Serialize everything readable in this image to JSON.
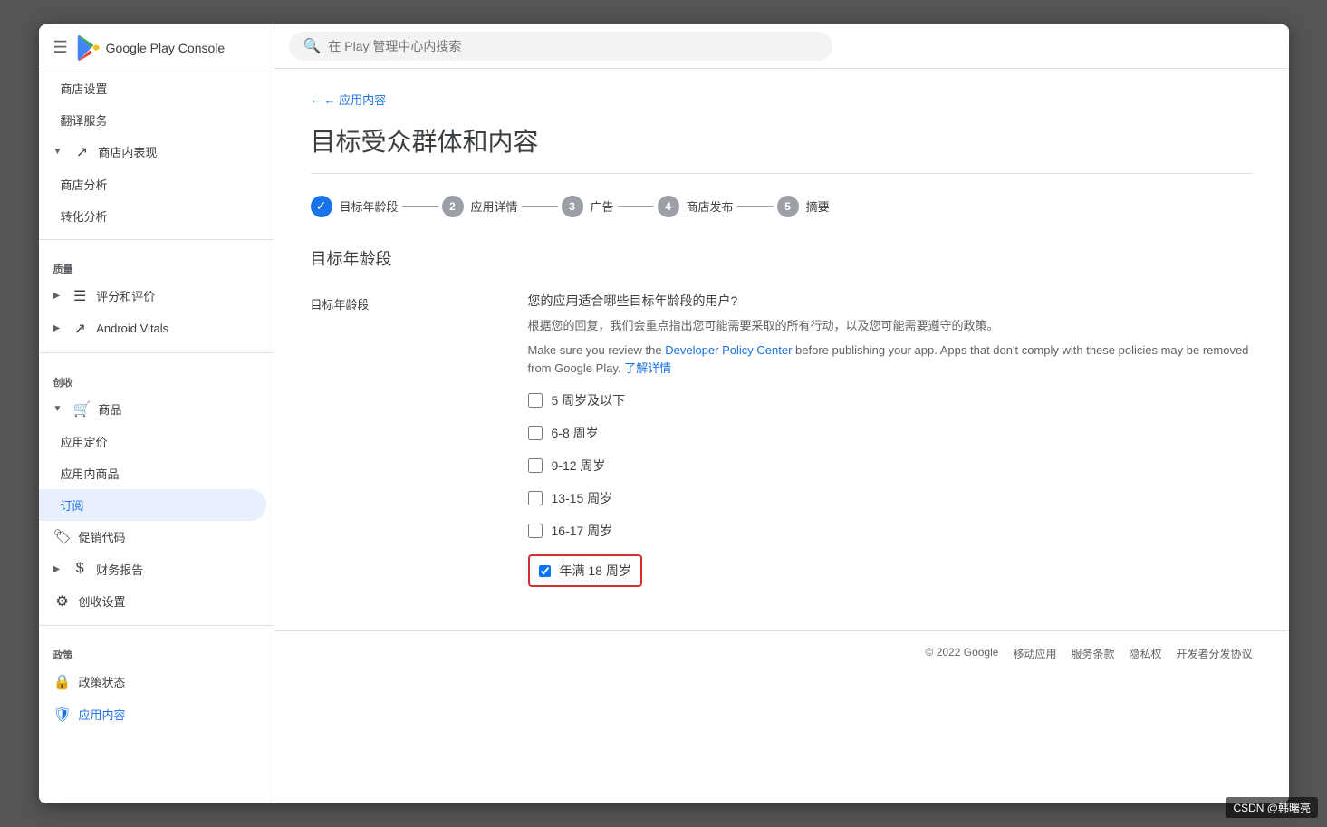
{
  "header": {
    "logo_text": "Google Play Console",
    "search_placeholder": "在 Play 管理中心内搜索"
  },
  "sidebar": {
    "items": [
      {
        "id": "store-settings",
        "label": "商店设置",
        "icon": "",
        "level": 1
      },
      {
        "id": "translation-service",
        "label": "翻译服务",
        "icon": "",
        "level": 1
      },
      {
        "id": "store-performance",
        "label": "商店内表现",
        "icon": "↗",
        "level": 0,
        "expandable": true
      },
      {
        "id": "store-analysis",
        "label": "商店分析",
        "icon": "",
        "level": 1
      },
      {
        "id": "conversion-analysis",
        "label": "转化分析",
        "icon": "",
        "level": 1
      },
      {
        "id": "quality-section",
        "label": "质量",
        "type": "section"
      },
      {
        "id": "ratings",
        "label": "评分和评价",
        "icon": "☰",
        "level": 0,
        "expandable": true
      },
      {
        "id": "android-vitals",
        "label": "Android Vitals",
        "icon": "↗",
        "level": 0,
        "expandable": true
      },
      {
        "id": "monetize-section",
        "label": "创收",
        "type": "section"
      },
      {
        "id": "products",
        "label": "商品",
        "icon": "🛒",
        "level": 0,
        "expandable": true,
        "expanded": true
      },
      {
        "id": "app-pricing",
        "label": "应用定价",
        "icon": "",
        "level": 1
      },
      {
        "id": "in-app-products",
        "label": "应用内商品",
        "icon": "",
        "level": 1
      },
      {
        "id": "subscriptions",
        "label": "订阅",
        "icon": "",
        "level": 1,
        "active": true
      },
      {
        "id": "promo-codes",
        "label": "促销代码",
        "icon": "🏷",
        "level": 0
      },
      {
        "id": "financial-reports",
        "label": "财务报告",
        "icon": "$",
        "level": 0,
        "expandable": true
      },
      {
        "id": "monetize-settings",
        "label": "创收设置",
        "icon": "⚙",
        "level": 0
      },
      {
        "id": "policy-section",
        "label": "政策",
        "type": "section"
      },
      {
        "id": "policy-status",
        "label": "政策状态",
        "icon": "🔒",
        "level": 0
      },
      {
        "id": "app-content",
        "label": "应用内容",
        "icon": "🛡",
        "level": 0,
        "active_nav": true
      }
    ]
  },
  "breadcrumb": {
    "text": "← 应用内容"
  },
  "page": {
    "title": "目标受众群体和内容"
  },
  "stepper": {
    "steps": [
      {
        "id": 1,
        "label": "目标年龄段",
        "status": "completed"
      },
      {
        "id": 2,
        "label": "应用详情",
        "status": "pending"
      },
      {
        "id": 3,
        "label": "广告",
        "status": "pending"
      },
      {
        "id": 4,
        "label": "商店发布",
        "status": "pending"
      },
      {
        "id": 5,
        "label": "摘要",
        "status": "pending"
      }
    ]
  },
  "section": {
    "title": "目标年龄段",
    "label": "目标年龄段",
    "question": "您的应用适合哪些目标年龄段的用户?",
    "description": "根据您的回复，我们会重点指出您可能需要采取的所有行动，以及您可能需要遵守的政策。",
    "description_en_pre": "Make sure you review the ",
    "description_en_link": "Developer Policy Center",
    "description_en_post": " before publishing your app. Apps that don't comply with these policies may be removed from Google Play.",
    "description_en_link2": "了解详情",
    "checkboxes": [
      {
        "id": "age1",
        "label": "5 周岁及以下",
        "checked": false
      },
      {
        "id": "age2",
        "label": "6-8 周岁",
        "checked": false
      },
      {
        "id": "age3",
        "label": "9-12 周岁",
        "checked": false
      },
      {
        "id": "age4",
        "label": "13-15 周岁",
        "checked": false
      },
      {
        "id": "age5",
        "label": "16-17 周岁",
        "checked": false
      },
      {
        "id": "age6",
        "label": "年满 18 周岁",
        "checked": true,
        "highlighted": true
      }
    ]
  },
  "footer": {
    "copyright": "© 2022 Google",
    "links": [
      "移动应用",
      "服务条款",
      "隐私权",
      "开发者分发协议"
    ]
  },
  "watermark": "CSDN @韩曙亮"
}
